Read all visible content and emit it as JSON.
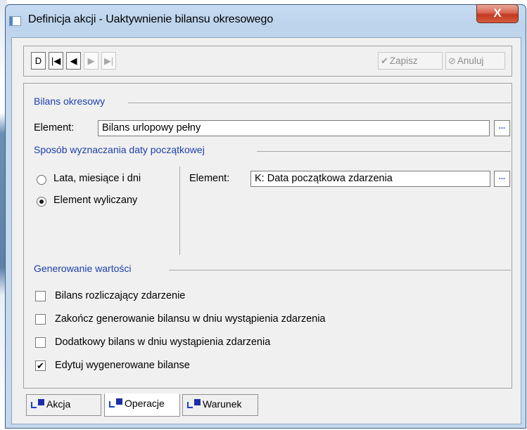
{
  "window": {
    "title": "Definicja akcji - Uaktywnienie bilansu okresowego",
    "close_label": "X"
  },
  "toolbar": {
    "nav": [
      {
        "name": "new-record-button",
        "label": "D",
        "enabled": true
      },
      {
        "name": "first-record-button",
        "label": "|◀",
        "enabled": true
      },
      {
        "name": "previous-record-button",
        "label": "◀",
        "enabled": true
      },
      {
        "name": "next-record-button",
        "label": "▶",
        "enabled": false
      },
      {
        "name": "last-record-button",
        "label": "▶|",
        "enabled": false
      }
    ],
    "save_label": "Zapisz",
    "cancel_label": "Anuluj",
    "save_icon": "check-icon",
    "cancel_icon": "cancel-icon"
  },
  "bilans_okresowy": {
    "section_title": "Bilans okresowy",
    "element_label": "Element:",
    "element_value": "Bilans urlopowy pełny",
    "browse_label": "..."
  },
  "sposob": {
    "section_title": "Sposób wyznaczania daty początkowej",
    "radio_options": [
      {
        "label": "Lata, miesiące i dni",
        "checked": false
      },
      {
        "label": "Element wyliczany",
        "checked": true
      }
    ],
    "element_label": "Element:",
    "element_value": "K: Data początkowa zdarzenia",
    "browse_label": "..."
  },
  "generowanie": {
    "section_title": "Generowanie wartości",
    "checkboxes": [
      {
        "label": "Bilans rozliczający zdarzenie",
        "checked": false
      },
      {
        "label": "Zakończ generowanie bilansu w dniu wystąpienia zdarzenia",
        "checked": false
      },
      {
        "label": "Dodatkowy bilans w dniu wystąpienia zdarzenia",
        "checked": false
      },
      {
        "label": "Edytuj wygenerowane bilanse",
        "checked": true
      }
    ]
  },
  "tabs": [
    {
      "label": "Akcja",
      "active": false
    },
    {
      "label": "Operacje",
      "active": true
    },
    {
      "label": "Warunek",
      "active": false
    }
  ],
  "colors": {
    "section_title": "#1c3faa",
    "title_bar": "#c4d8ee",
    "close_button": "#c43a22"
  }
}
